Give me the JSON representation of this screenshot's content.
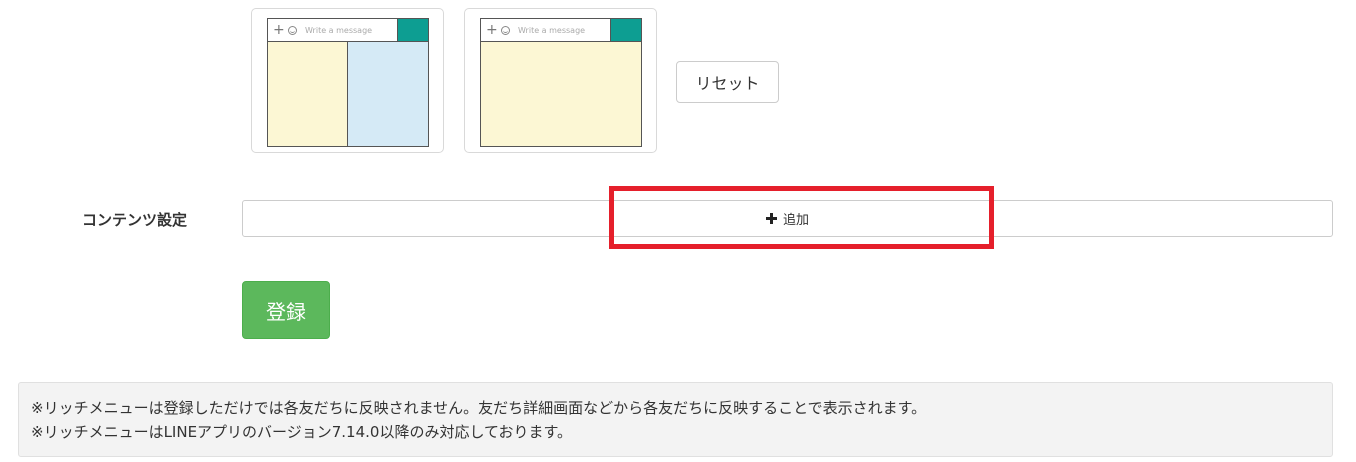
{
  "layouts": [
    {
      "bar_text": "Write a message",
      "areas": [
        "A",
        "B"
      ],
      "send_color": "#0d9e92",
      "area_colors": [
        "#fcf7d4",
        "#d5eaf6"
      ]
    },
    {
      "bar_text": "Write a message",
      "areas": [
        "A"
      ],
      "send_color": "#0d9e92",
      "area_colors": [
        "#fcf7d4"
      ]
    }
  ],
  "reset_label": "リセット",
  "content_settings": {
    "label": "コンテンツ設定",
    "add_label": "追加"
  },
  "register_label": "登録",
  "colors": {
    "register": "#5cb85c",
    "highlight": "#e51f2b"
  },
  "notices": [
    "※リッチメニューは登録しただけでは各友だちに反映されません。友だち詳細画面などから各友だちに反映することで表示されます。",
    "※リッチメニューはLINEアプリのバージョン7.14.0以降のみ対応しております。"
  ]
}
